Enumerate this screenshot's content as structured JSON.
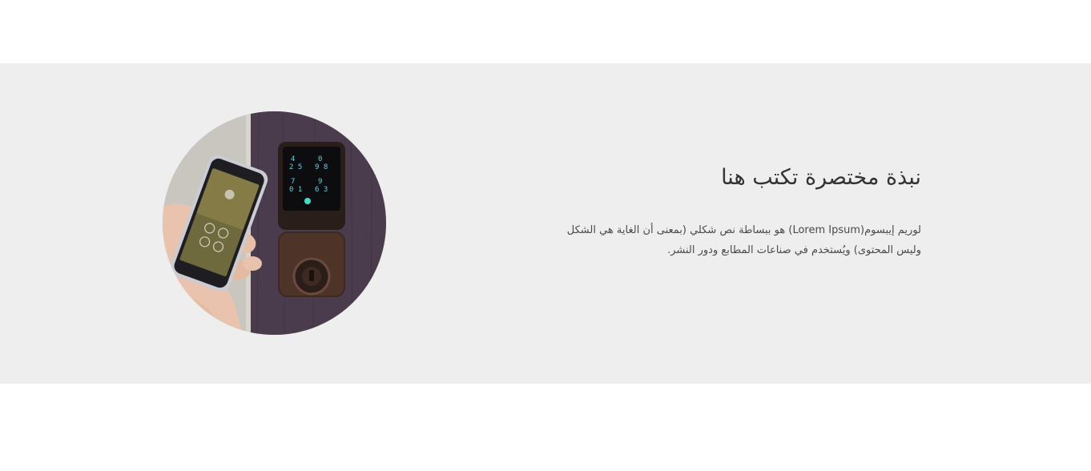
{
  "section": {
    "heading": "نبذة مختصرة تكتب هنا",
    "paragraph": "لوريم إيبسوم(Lorem Ipsum) هو ببساطة نص شكلي (بمعنى أن الغاية هي الشكل وليس المحتوى) ويُستخدم في صناعات المطابع ودور النشر."
  },
  "photo": {
    "subject": "smart-lock-with-phone"
  },
  "colors": {
    "band_background": "#eeeeee",
    "heading_text": "#333333",
    "body_text": "#4a4a4a"
  }
}
